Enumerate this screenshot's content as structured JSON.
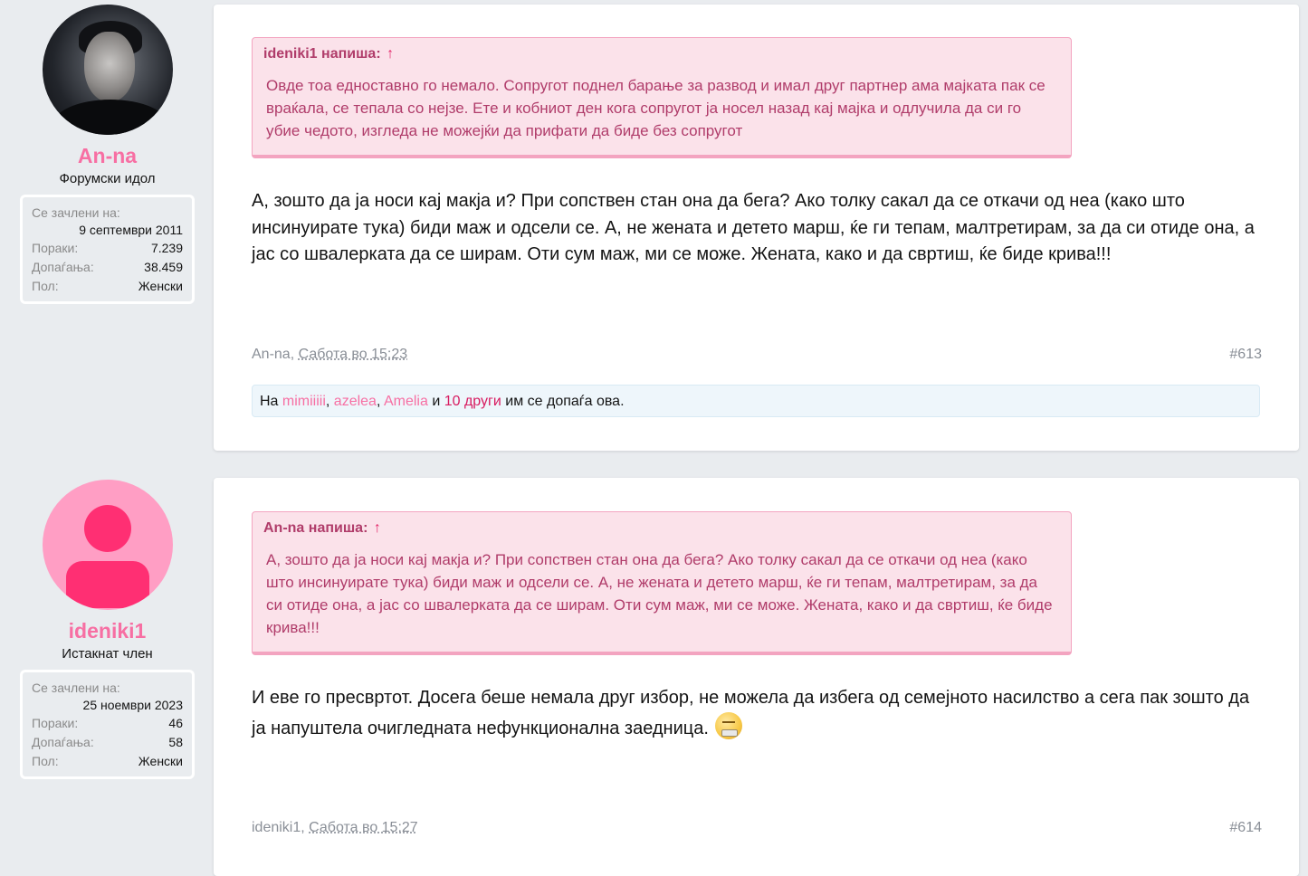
{
  "posts": [
    {
      "user": {
        "name": "An-na",
        "title": "Форумски идол",
        "joined_label": "Се зачлени на:",
        "joined_value": "9 септември 2011",
        "posts_label": "Пораки:",
        "posts_value": "7.239",
        "likes_label": "Допаѓања:",
        "likes_value": "38.459",
        "gender_label": "Пол:",
        "gender_value": "Женски"
      },
      "quote": {
        "author": "ideniki1 напиша:",
        "arrow": "↑",
        "text": "Овде тоа едноставно го немало. Сопругот поднел барање за развод и имал друг партнер ама мајката пак се враќала, се тепала со нејзе. Ете и кобниот ден кога сопругот ја носел назад кај мајка и одлучила да си го убие чедото, изгледа не можејќи да прифати да биде без сопругот"
      },
      "message": "А, зошто да ја носи кај макја и? При сопствен стан она да бега? Ако толку сакал да се откачи од неа (како што инсинуирате тука) биди маж и одсели се. А, не жената и детето марш, ќе ги тепам, малтретирам, за да си отиде она, а јас со швалерката да се ширам. Оти сум маж, ми се може. Жената, како и да свртиш, ќе биде крива!!!",
      "footer": {
        "author": "An-na",
        "separator": ", ",
        "date": "Сабота во 15:23",
        "number": "#613"
      },
      "likes": {
        "prefix": "На",
        "user1": "mimiiiii",
        "sep1": ",",
        "user2": "azelea",
        "sep2": ",",
        "user3": "Amelia",
        "and": "и",
        "others": "10 други",
        "suffix": "им се допаѓа ова."
      }
    },
    {
      "user": {
        "name": "ideniki1",
        "title": "Истакнат член",
        "joined_label": "Се зачлени на:",
        "joined_value": "25 ноември 2023",
        "posts_label": "Пораки:",
        "posts_value": "46",
        "likes_label": "Допаѓања:",
        "likes_value": "58",
        "gender_label": "Пол:",
        "gender_value": "Женски"
      },
      "quote": {
        "author": "An-na напиша:",
        "arrow": "↑",
        "text": "А, зошто да ја носи кај макја и? При сопствен стан она да бега? Ако толку сакал да се откачи од неа (како што инсинуирате тука) биди маж и одсели се. А, не жената и детето марш, ќе ги тепам, малтретирам, за да си отиде она, а јас со швалерката да се ширам. Оти сум маж, ми се може. Жената, како и да свртиш, ќе биде крива!!!"
      },
      "message": "И еве го пресвртот. Досега беше немала друг избор, не можела да избега од семејното насилство а сега пак зошто да ја напуштела очигледната нефункционална заедница.",
      "emoji_icon": "straight-face-emoji",
      "footer": {
        "author": "ideniki1",
        "separator": ", ",
        "date": "Сабота во 15:27",
        "number": "#614"
      }
    }
  ],
  "colors": {
    "accent_pink": "#f76fa3",
    "quote_bg": "#fbe2ea",
    "quote_text": "#b03c6a",
    "likes_bg": "#eef6fb"
  }
}
